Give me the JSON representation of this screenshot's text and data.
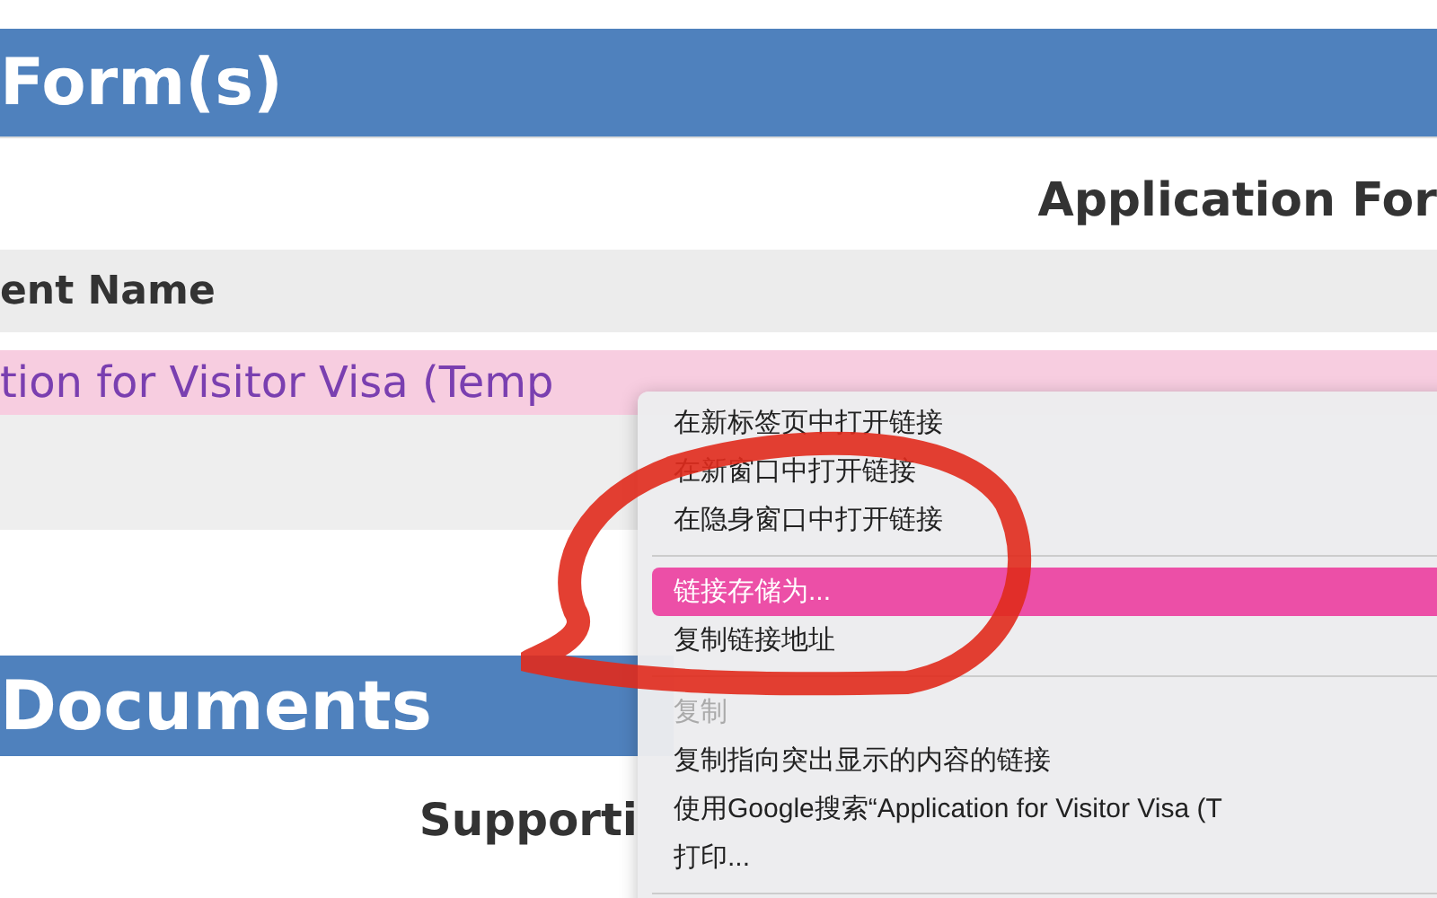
{
  "forms_section": {
    "title": "Form(s)",
    "table_title": "Application For",
    "column_header": "ent Name",
    "link": "tion for Visitor Visa (Temp"
  },
  "documents_section": {
    "title": "Documents",
    "table_title": "Supporti"
  },
  "context_menu": [
    {
      "kind": "item",
      "label": "在新标签页中打开链接",
      "selected": false,
      "disabled": false
    },
    {
      "kind": "item",
      "label": "在新窗口中打开链接",
      "selected": false,
      "disabled": false
    },
    {
      "kind": "item",
      "label": "在隐身窗口中打开链接",
      "selected": false,
      "disabled": false
    },
    {
      "kind": "separator"
    },
    {
      "kind": "item",
      "label": "链接存储为...",
      "selected": true,
      "disabled": false
    },
    {
      "kind": "item",
      "label": "复制链接地址",
      "selected": false,
      "disabled": false
    },
    {
      "kind": "separator"
    },
    {
      "kind": "item",
      "label": "复制",
      "selected": false,
      "disabled": true
    },
    {
      "kind": "item",
      "label": "复制指向突出显示的内容的链接",
      "selected": false,
      "disabled": false
    },
    {
      "kind": "item",
      "label": "使用Google搜索“Application for Visitor Visa (T",
      "selected": false,
      "disabled": false
    },
    {
      "kind": "item",
      "label": "打印...",
      "selected": false,
      "disabled": false
    },
    {
      "kind": "separator"
    }
  ]
}
